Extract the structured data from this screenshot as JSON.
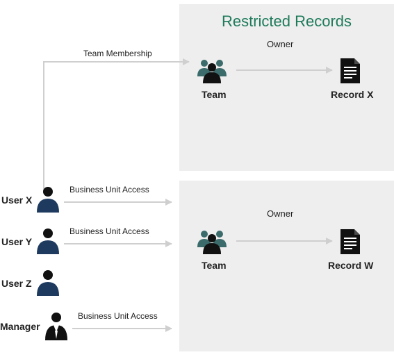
{
  "title": "Restricted Records",
  "top": {
    "owner_label": "Owner",
    "team_label": "Team",
    "record_label": "Record X",
    "membership_label": "Team Membership"
  },
  "bottom": {
    "owner_label": "Owner",
    "team_label": "Team",
    "record_label": "Record W"
  },
  "users": {
    "x": {
      "label": "User X",
      "access": "Business Unit Access"
    },
    "y": {
      "label": "User Y",
      "access": "Business Unit Access"
    },
    "z": {
      "label": "User Z"
    },
    "manager": {
      "label": "Manager",
      "access": "Business Unit Access"
    }
  },
  "colors": {
    "navy": "#1e3a5f",
    "black": "#111111",
    "teal": "#3b6b6b"
  }
}
